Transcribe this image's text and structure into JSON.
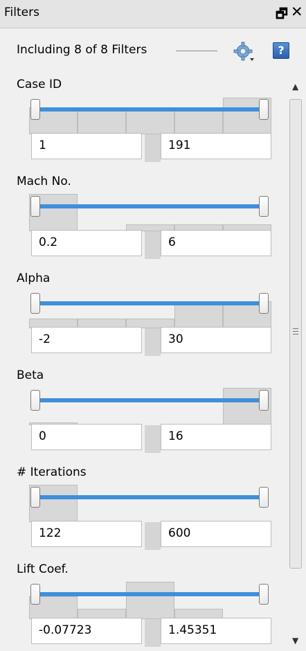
{
  "title_bar": {
    "title": "Filters",
    "restore_glyph": "🗗",
    "close_glyph": "✕"
  },
  "summary": {
    "text": "Including 8 of 8 Filters",
    "settings_icon": "gear-icon",
    "help_label": "?"
  },
  "colors": {
    "slider_track": "#3f8fdc",
    "histogram_bar": "#d8d8d8"
  },
  "filters": [
    {
      "label": "Case ID",
      "min": "1",
      "max": "191",
      "range_min_fraction": 0,
      "range_max_fraction": 1,
      "histogram": [
        0.72,
        0.72,
        0.72,
        0.72,
        0.99
      ]
    },
    {
      "label": "Mach No.",
      "min": "0.2",
      "max": "6",
      "range_min_fraction": 0,
      "range_max_fraction": 1,
      "histogram": [
        1.0,
        0.0,
        0.18,
        0.18,
        0.18
      ]
    },
    {
      "label": "Alpha",
      "min": "-2",
      "max": "30",
      "range_min_fraction": 0,
      "range_max_fraction": 1,
      "histogram": [
        0.26,
        0.26,
        0.26,
        0.72,
        0.72
      ]
    },
    {
      "label": "Beta",
      "min": "0",
      "max": "16",
      "range_min_fraction": 0,
      "range_max_fraction": 1,
      "histogram": [
        0.08,
        0.0,
        0.0,
        0.0,
        1.0
      ]
    },
    {
      "label": "# Iterations",
      "min": "122",
      "max": "600",
      "range_min_fraction": 0,
      "range_max_fraction": 1,
      "histogram": [
        1.0,
        0.0,
        0.0,
        0.0,
        0.0
      ]
    },
    {
      "label": "Lift Coef.",
      "min": "-0.07723",
      "max": "1.45351",
      "range_min_fraction": 0,
      "range_max_fraction": 1,
      "histogram": [
        0.62,
        0.28,
        1.0,
        0.28,
        0.0
      ]
    }
  ]
}
